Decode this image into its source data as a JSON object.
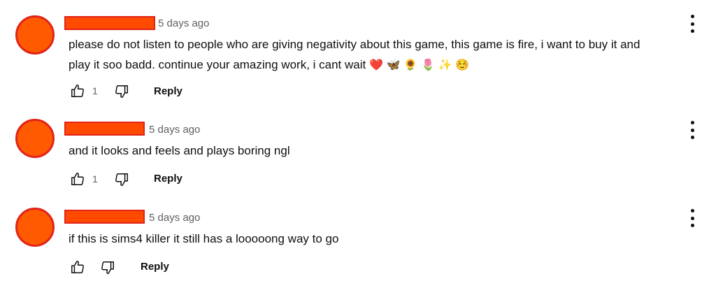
{
  "comments": [
    {
      "time": "5 days ago",
      "text_line1": "please do not listen to people who are giving negativity about this game, this game is fire, i want to buy it and",
      "text_line2": "play it soo badd. continue your amazing work, i cant wait",
      "emojis": [
        "❤️",
        "🦋",
        "🌻",
        "🌷",
        "✨",
        "☺️"
      ],
      "likes": "1",
      "reply_label": "Reply"
    },
    {
      "time": "5 days ago",
      "text_line1": "and it looks and feels and plays boring ngl",
      "likes": "1",
      "reply_label": "Reply"
    },
    {
      "time": "5 days ago",
      "text_line1": "if this is sims4 killer it still has a looooong way to go",
      "likes": "",
      "reply_label": "Reply"
    }
  ],
  "colors": {
    "avatar_fill": "#ff5a00",
    "redaction": "#ff4a00",
    "redaction_border": "#e2231a"
  },
  "icons": {
    "like": "thumbs-up-icon",
    "dislike": "thumbs-down-icon",
    "menu": "vertical-ellipsis-icon"
  }
}
